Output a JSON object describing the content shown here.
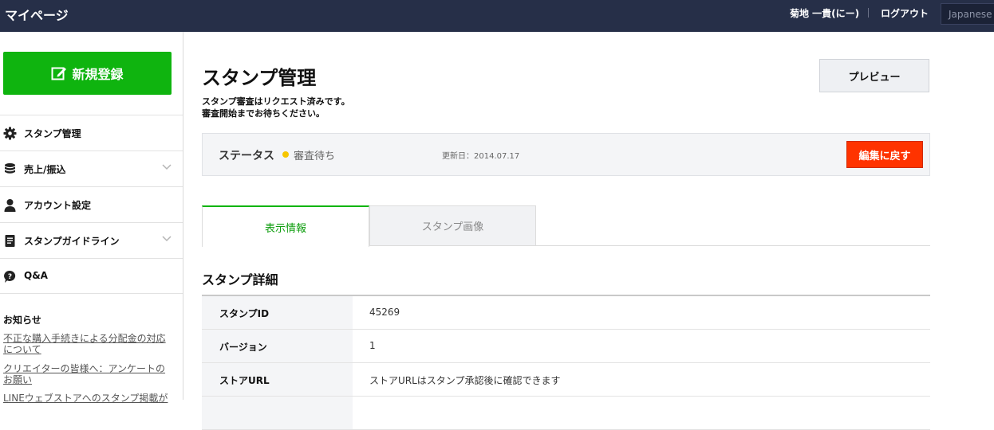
{
  "header": {
    "app_title": "マイページ",
    "user_name": "菊地 一貴(にー)",
    "logout": "ログアウト",
    "language": "Japanese"
  },
  "sidebar": {
    "new_button": "新規登録",
    "items": [
      {
        "label": "スタンプ管理",
        "icon": "gear-icon",
        "expandable": false
      },
      {
        "label": "売上/振込",
        "icon": "coins-icon",
        "expandable": true
      },
      {
        "label": "アカウント設定",
        "icon": "user-icon",
        "expandable": false
      },
      {
        "label": "スタンプガイドライン",
        "icon": "document-icon",
        "expandable": true
      },
      {
        "label": "Q&A",
        "icon": "question-bubble-icon",
        "expandable": false
      }
    ],
    "notice_title": "お知らせ",
    "notices": [
      "不正な購入手続きによる分配金の対応について",
      "クリエイターの皆様へ：アンケートのお願い",
      "LINEウェブストアへのスタンプ掲載が"
    ]
  },
  "main": {
    "title": "スタンプ管理",
    "message_line1": "スタンプ審査はリクエスト済みです。",
    "message_line2": "審査開始までお待ちください。",
    "preview_button": "プレビュー",
    "status": {
      "label": "ステータス",
      "value": "審査待ち",
      "dot_color": "#f6c600",
      "updated": "更新日：2014.07.17",
      "back_button": "編集に戻す"
    },
    "tabs": [
      {
        "label": "表示情報",
        "active": true
      },
      {
        "label": "スタンプ画像",
        "active": false
      }
    ],
    "section_title": "スタンプ詳細",
    "details": [
      {
        "key": "スタンプID",
        "value": "45269"
      },
      {
        "key": "バージョン",
        "value": "1"
      },
      {
        "key": "ストアURL",
        "value": "ストアURLはスタンプ承認後に確認できます"
      }
    ]
  },
  "colors": {
    "header_bg": "#262f48",
    "primary_green": "#0fb40f",
    "danger_red": "#ff3300"
  }
}
